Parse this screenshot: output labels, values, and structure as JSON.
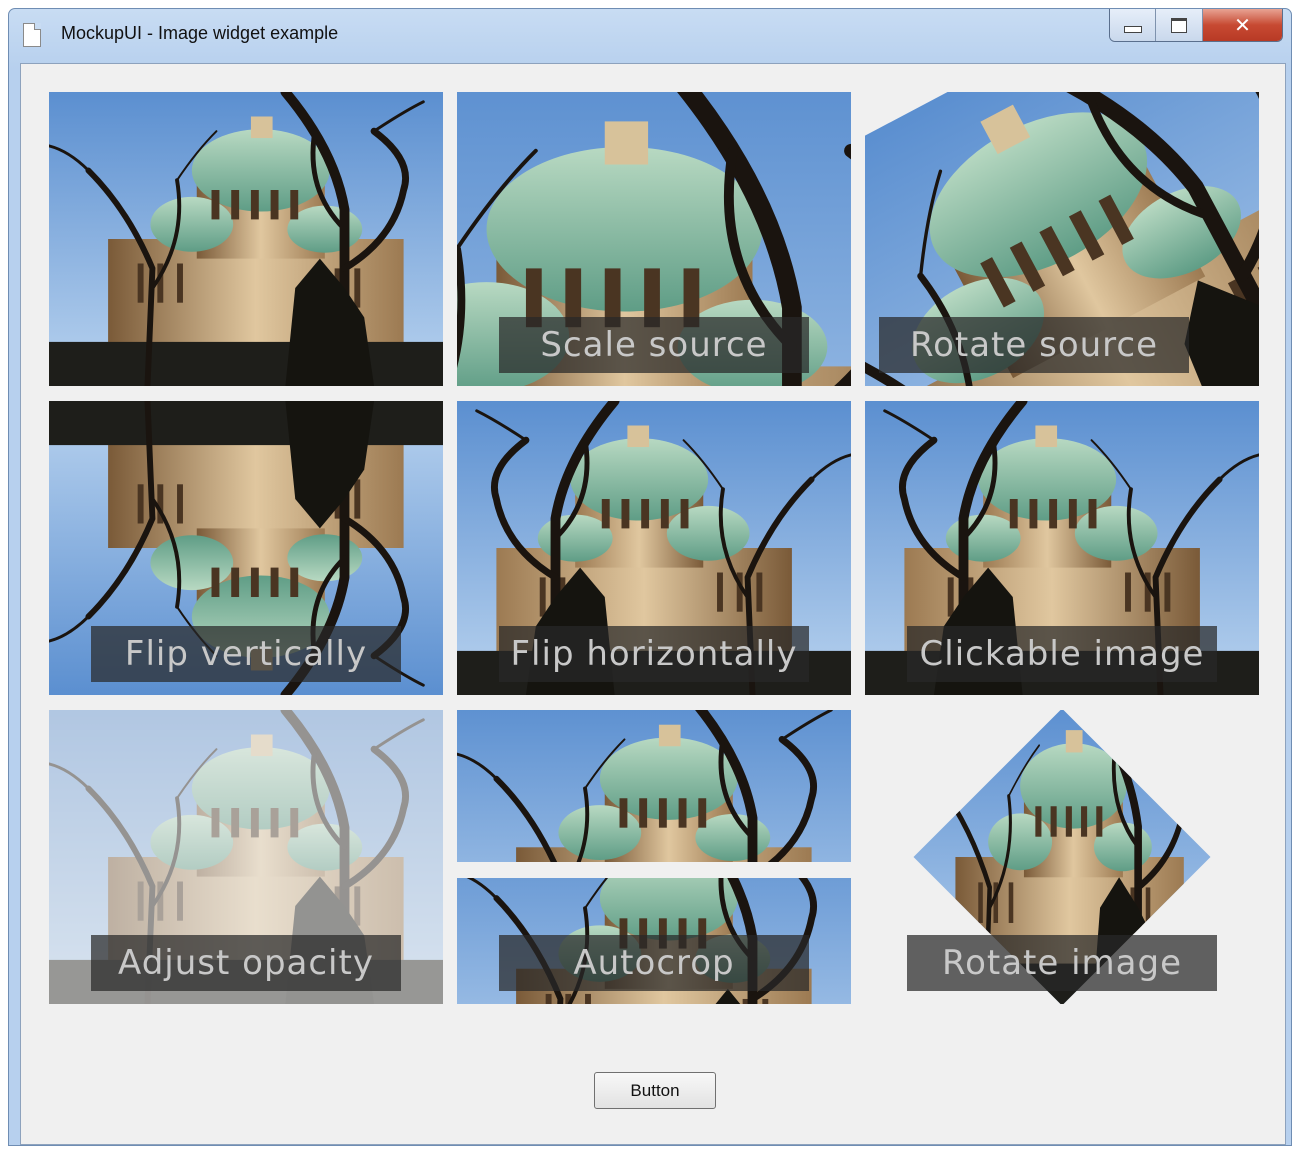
{
  "window": {
    "title": "MockupUI - Image widget example",
    "controls": {
      "minimize": "minimize-icon",
      "maximize": "maximize-icon",
      "close": "✕"
    }
  },
  "tiles": [
    {
      "id": "original",
      "caption": ""
    },
    {
      "id": "scale-source",
      "caption": "Scale source"
    },
    {
      "id": "rotate-source",
      "caption": "Rotate source"
    },
    {
      "id": "flip-vertically",
      "caption": "Flip vertically"
    },
    {
      "id": "flip-horizontally",
      "caption": "Flip horizontally"
    },
    {
      "id": "clickable-image",
      "caption": "Clickable image"
    },
    {
      "id": "adjust-opacity",
      "caption": "Adjust opacity"
    },
    {
      "id": "autocrop",
      "caption": "Autocrop"
    },
    {
      "id": "rotate-image",
      "caption": "Rotate image"
    }
  ],
  "button": {
    "label": "Button"
  },
  "colors": {
    "sky": "#8fb7e3",
    "building": "#c9a97a",
    "dome": "#8fbfa3",
    "tree": "#1a140f",
    "ground": "#1e1e1a"
  }
}
